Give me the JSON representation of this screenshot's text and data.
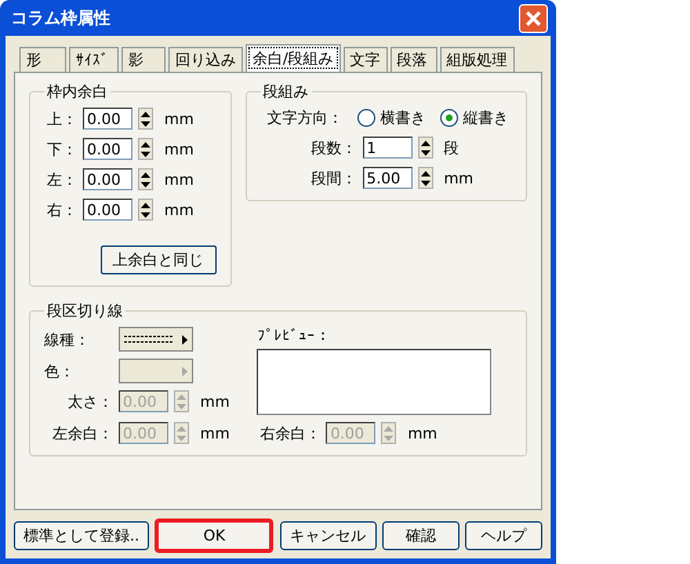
{
  "window": {
    "title": "コラム枠属性"
  },
  "tabs": [
    {
      "label": "形",
      "selected": false
    },
    {
      "label": "ｻｲｽﾞ",
      "selected": false
    },
    {
      "label": "影",
      "selected": false
    },
    {
      "label": "回り込み",
      "selected": false
    },
    {
      "label": "余白/段組み",
      "selected": true
    },
    {
      "label": "文字",
      "selected": false
    },
    {
      "label": "段落",
      "selected": false
    },
    {
      "label": "組版処理",
      "selected": false
    }
  ],
  "inner_margin": {
    "title": "枠内余白",
    "rows": [
      {
        "label": "上：",
        "value": "0.00",
        "unit": "mm"
      },
      {
        "label": "下：",
        "value": "0.00",
        "unit": "mm"
      },
      {
        "label": "左：",
        "value": "0.00",
        "unit": "mm"
      },
      {
        "label": "右：",
        "value": "0.00",
        "unit": "mm"
      }
    ],
    "button": "上余白と同じ"
  },
  "columns": {
    "title": "段組み",
    "direction_label": "文字方向：",
    "options": [
      {
        "label": "横書き",
        "selected": false
      },
      {
        "label": "縦書き",
        "selected": true
      }
    ],
    "rows": [
      {
        "label": "段数：",
        "value": "1",
        "unit": "段"
      },
      {
        "label": "段間：",
        "value": "5.00",
        "unit": "mm"
      }
    ]
  },
  "column_rule": {
    "title": "段区切り線",
    "line_type": {
      "label": "線種：",
      "disabled": false
    },
    "color": {
      "label": "色：",
      "disabled": true
    },
    "thickness": {
      "label": "太さ：",
      "value": "0.00",
      "unit": "mm",
      "disabled": true
    },
    "preview_label": "ﾌﾟﾚﾋﾞｭｰ：",
    "left_margin": {
      "label": "左余白：",
      "value": "0.00",
      "unit": "mm",
      "disabled": true
    },
    "right_margin": {
      "label": "右余白：",
      "value": "0.00",
      "unit": "mm",
      "disabled": true
    }
  },
  "buttons": [
    {
      "label": "標準として登録..",
      "highlighted": false
    },
    {
      "label": "OK",
      "highlighted": true
    },
    {
      "label": "キャンセル",
      "highlighted": false
    },
    {
      "label": "確認",
      "highlighted": false
    },
    {
      "label": "ヘルプ",
      "highlighted": false
    }
  ]
}
